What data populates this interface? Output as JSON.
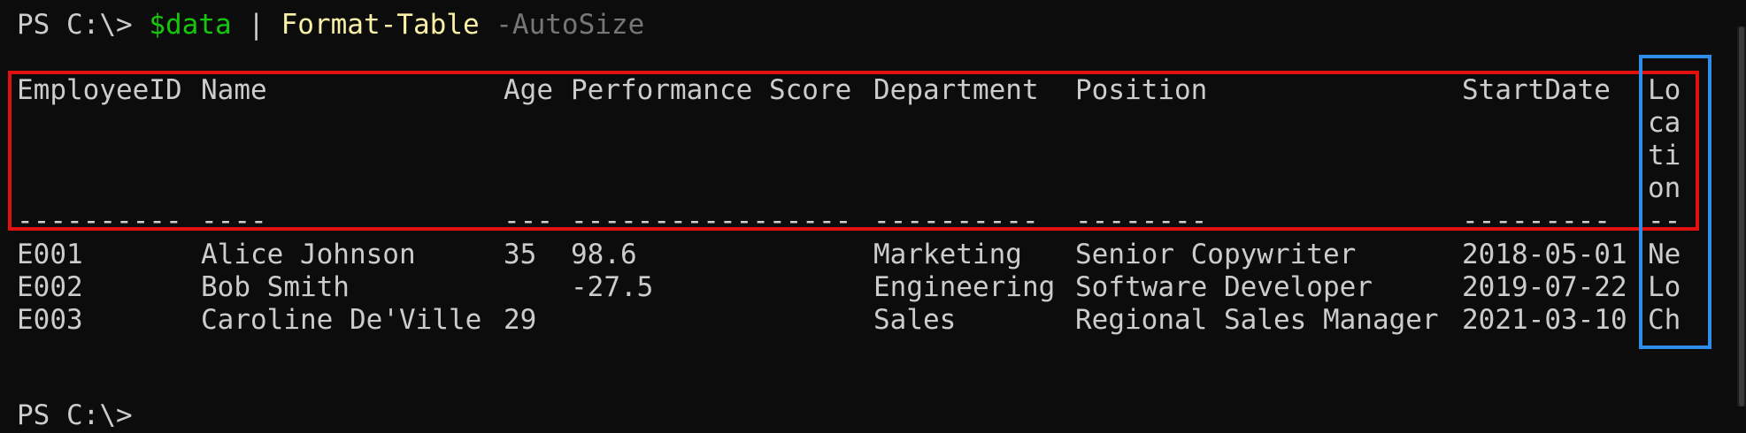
{
  "command_line": {
    "prompt": "PS C:\\> ",
    "variable": "$data",
    "pipe": " | ",
    "cmdlet": "Format-Table",
    "parameter": " -AutoSize"
  },
  "table": {
    "headers": {
      "employee_id": "EmployeeID",
      "name": "Name",
      "age": "Age",
      "performance_score": "Performance Score",
      "department": "Department",
      "position": "Position",
      "start_date": "StartDate",
      "location_lines": [
        "Lo",
        "ca",
        "ti",
        "on"
      ]
    },
    "underlines": {
      "employee_id": "----------",
      "name": "----",
      "age": "---",
      "performance_score": "-----------------",
      "department": "----------",
      "position": "--------",
      "start_date": "---------",
      "location": "--"
    },
    "rows": [
      {
        "employee_id": "E001",
        "name": "Alice Johnson",
        "age": "35",
        "performance_score": "98.6",
        "department": "Marketing",
        "position": "Senior Copywriter",
        "start_date": "2018-05-01",
        "location": "Ne"
      },
      {
        "employee_id": "E002",
        "name": "Bob Smith",
        "age": "",
        "performance_score": "-27.5",
        "department": "Engineering",
        "position": "Software Developer",
        "start_date": "2019-07-22",
        "location": "Lo"
      },
      {
        "employee_id": "E003",
        "name": "Caroline De'Ville",
        "age": "29",
        "performance_score": "",
        "department": "Sales",
        "position": "Regional Sales Manager",
        "start_date": "2021-03-10",
        "location": "Ch"
      }
    ]
  },
  "final_prompt": "PS C:\\>",
  "colors": {
    "background": "#0c0c0c",
    "foreground": "#cccccc",
    "variable": "#16c60c",
    "cmdlet": "#f9f1a5",
    "parameter": "#767676",
    "highlight_red": "#e31010",
    "highlight_blue": "#2e8de8"
  }
}
